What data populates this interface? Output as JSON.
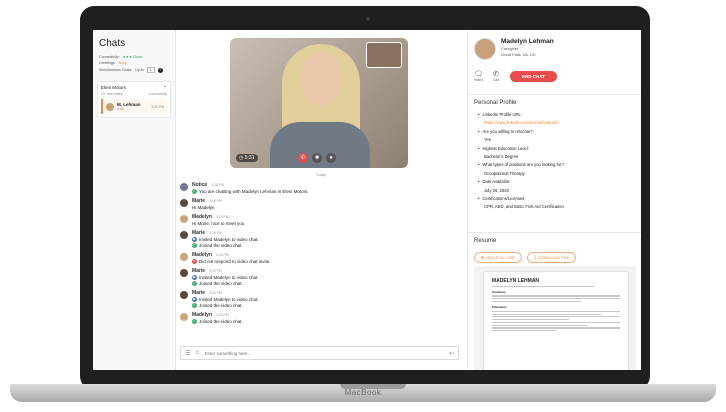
{
  "device": {
    "base_label": "MacBook"
  },
  "chats": {
    "title": "Chats",
    "stats": [
      {
        "label": "Connectivity:",
        "value": "★★★ Good"
      },
      {
        "label": "Greetings:",
        "value": "Busy"
      },
      {
        "label": "Simultaneous Chats:",
        "value": "Up to",
        "select": "1"
      }
    ],
    "help_glyph": "?",
    "group": {
      "name": "Eleni Motors",
      "sub_left": "1/1 chat active",
      "sub_right": "Cust activity"
    },
    "item": {
      "name": "M. Lehman",
      "time": "0:41",
      "right": "3:20 PM"
    }
  },
  "video": {
    "timer": "5:31",
    "day_label": "Today"
  },
  "messages": [
    {
      "who": "notice",
      "name": "Notice",
      "time": "3:18 PM",
      "lines": [
        {
          "icon": "ok",
          "text": "You are chatting with Madelyn Lehman in Eleni Motors."
        }
      ]
    },
    {
      "who": "marie",
      "name": "Marie",
      "time": "3:18 PM",
      "lines": [
        {
          "icon": "",
          "text": "Hi Madelyn"
        }
      ]
    },
    {
      "who": "mad",
      "name": "Madelyn",
      "time": "3:18 PM",
      "lines": [
        {
          "icon": "",
          "text": "Hi Marie, nice to meet you"
        }
      ]
    },
    {
      "who": "marie",
      "name": "Marie",
      "time": "3:18 PM",
      "lines": [
        {
          "icon": "vid",
          "text": "Invited Madelyn to video chat."
        },
        {
          "icon": "ok",
          "text": "Joined the video chat."
        }
      ]
    },
    {
      "who": "mad",
      "name": "Madelyn",
      "time": "3:20 PM",
      "lines": [
        {
          "icon": "bad",
          "text": "Did not respond to video chat invite."
        }
      ]
    },
    {
      "who": "marie",
      "name": "Marie",
      "time": "3:20 PM",
      "lines": [
        {
          "icon": "vid",
          "text": "Invited Madelyn to video chat."
        },
        {
          "icon": "ok",
          "text": "Joined the video chat."
        }
      ]
    },
    {
      "who": "marie",
      "name": "Marie",
      "time": "3:20 PM",
      "lines": [
        {
          "icon": "vid",
          "text": "Invited Madelyn to video chat."
        },
        {
          "icon": "ok",
          "text": "Joined the video chat."
        }
      ]
    },
    {
      "who": "mad",
      "name": "Madelyn",
      "time": "3:20 PM",
      "lines": [
        {
          "icon": "ok",
          "text": "Joined the video chat."
        }
      ]
    }
  ],
  "composer": {
    "placeholder": "Enter something here..."
  },
  "profile": {
    "name": "Madelyn Lehman",
    "role": "Caregiver",
    "location": "Great Falls, VA, US",
    "actions": [
      {
        "label": "Video",
        "icon": "🗨"
      },
      {
        "label": "Call",
        "icon": "✆"
      }
    ],
    "end_chat": "END CHAT",
    "section_title": "Personal Profile",
    "fields": [
      {
        "q": "LinkedIn Profile URL:",
        "a": "https://www.linkedin.com/in/mlehman15/",
        "link": true
      },
      {
        "q": "Are you willing to relocate?:",
        "a": "Yes"
      },
      {
        "q": "Highest Education Level:",
        "a": "Bachelor's Degree"
      },
      {
        "q": "What types of positions are you looking for?:",
        "a": "Occupational Therapy"
      },
      {
        "q": "Date Available:",
        "a": "July 26, 2020"
      },
      {
        "q": "Certifications/Licenses:",
        "a": "CPR, AED, and Basic First Aid Certification"
      }
    ]
  },
  "resume": {
    "title": "Resume",
    "view_btn": "VIEW FULL SIZE",
    "download_btn": "DOWNLOAD PDF",
    "doc_name": "MADELYN LEHMAN",
    "doc_sections": [
      "Summary",
      "Education"
    ]
  }
}
